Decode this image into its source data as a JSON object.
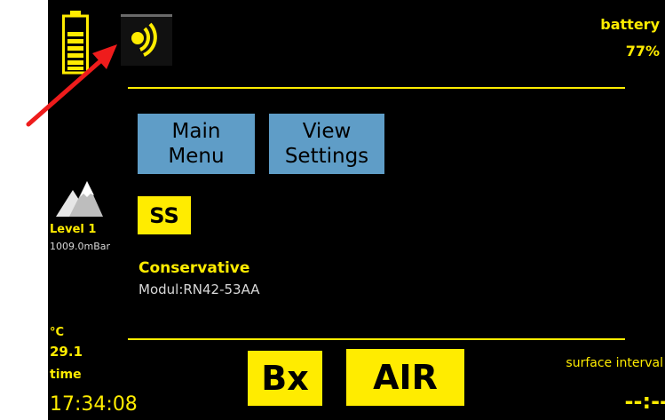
{
  "status": {
    "battery_label": "battery",
    "battery_percent": "77%",
    "battery_level_fraction": 0.77,
    "bluetooth_icon": "bluetooth-signal-icon"
  },
  "menu": {
    "main_menu_line1": "Main",
    "main_menu_line2": "Menu",
    "view_settings_line1": "View",
    "view_settings_line2": "Settings"
  },
  "mode_badge": "SS",
  "altitude": {
    "icon": "mountain-icon",
    "level": "Level 1",
    "pressure": "1009.0mBar"
  },
  "deco": {
    "conservatism": "Conservative",
    "module": "Modul:RN42-53AA"
  },
  "environment": {
    "temp_unit": "°C",
    "temperature": "29.1",
    "time_label": "time",
    "time": "17:34:08"
  },
  "gas": {
    "left": "Bx",
    "right": "AIR"
  },
  "surface": {
    "label": "surface interval",
    "value": "--:--"
  },
  "colors": {
    "accent": "#ffec00",
    "button": "#5f9dc7",
    "background": "#000000",
    "annotation_arrow": "#ee1c1c"
  }
}
